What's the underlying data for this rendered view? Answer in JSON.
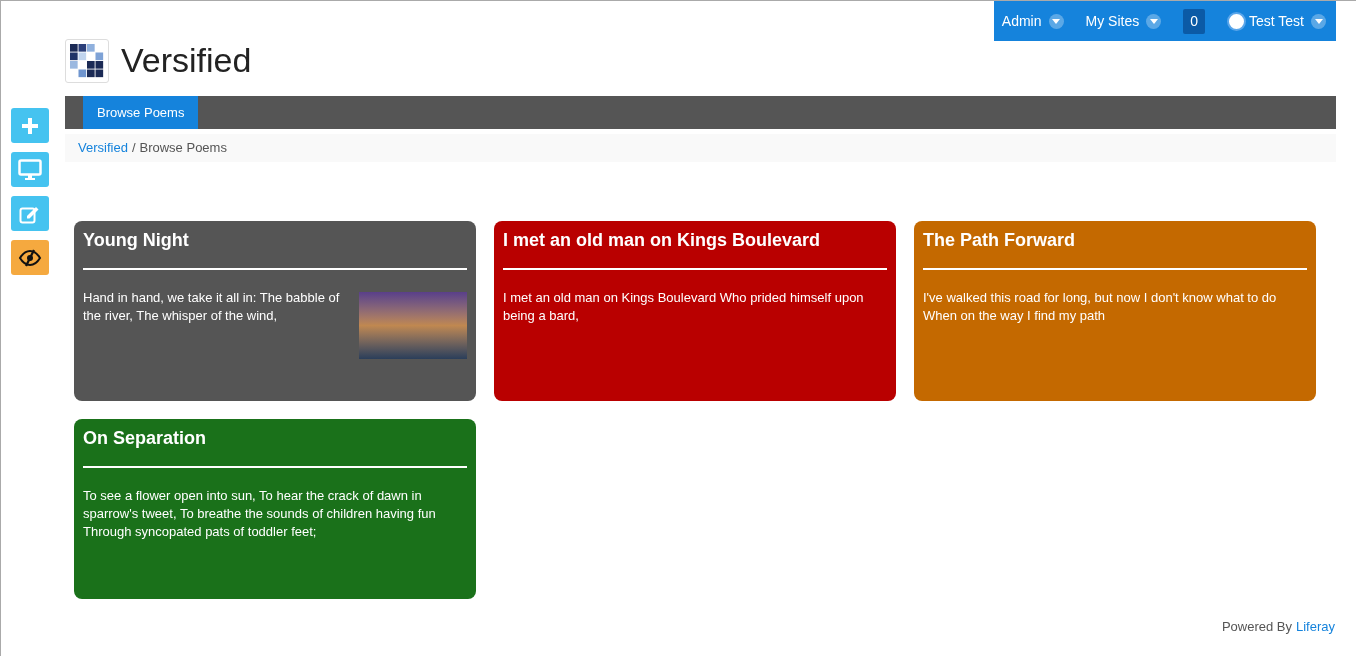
{
  "top_bar": {
    "items": [
      {
        "kind": "menu",
        "label": "Admin"
      },
      {
        "kind": "menu",
        "label": "My Sites"
      },
      {
        "kind": "count",
        "label": "0"
      },
      {
        "kind": "user",
        "label": "Test Test"
      }
    ]
  },
  "site": {
    "title": "Versified"
  },
  "nav": {
    "items": [
      {
        "label": "Browse Poems",
        "selected": true
      }
    ]
  },
  "breadcrumb": [
    {
      "label": "Versified",
      "link": true
    },
    {
      "label": "/",
      "link": false
    },
    {
      "label": "Browse Poems",
      "link": false
    }
  ],
  "tools": [
    {
      "kind": "add",
      "on": false
    },
    {
      "kind": "preview",
      "on": false
    },
    {
      "kind": "edit",
      "on": false
    },
    {
      "kind": "toggle-controls",
      "on": true
    }
  ],
  "poems": [
    {
      "kind": "with-image",
      "title": "Young Night",
      "excerpt": "Hand in hand, we take it all in: The babble of the river, The whisper of the wind,",
      "color": "#555555"
    },
    {
      "kind": "text",
      "title": "I met an old man on Kings Boulevard",
      "excerpt": "I met an old man on Kings Boulevard Who prided himself upon being a bard,",
      "color": "#b90000"
    },
    {
      "kind": "text",
      "title": "The Path Forward",
      "excerpt": "I've walked this road for long, but now I don't know what to do When on the way I find my path",
      "color": "#c46900"
    },
    {
      "kind": "text",
      "title": "On Separation",
      "excerpt": "To see a flower open into sun, To hear the crack of dawn in sparrow's tweet, To breathe the sounds of children having fun Through syncopated pats of toddler feet;",
      "color": "#1a711a"
    }
  ],
  "footer": {
    "text": "Powered By",
    "link": "Liferay"
  }
}
